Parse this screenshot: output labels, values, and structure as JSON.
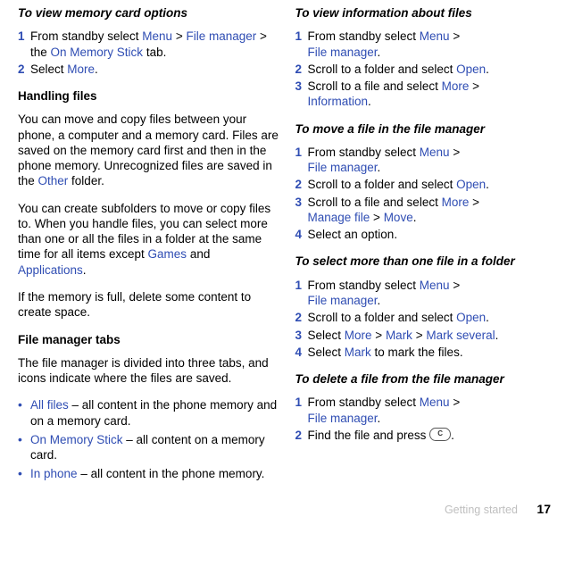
{
  "col_left": {
    "h1": "To view memory card options",
    "s1": {
      "n1": "1",
      "n2": "2",
      "t1a": "From standby select ",
      "t1_menu": "Menu",
      "t1b": " > ",
      "t1_file_manager": "File manager",
      "t1c": " > the ",
      "t1_on_mem": "On Memory Stick",
      "t1d": " tab.",
      "t2a": "Select ",
      "t2_more": "More",
      "t2b": "."
    },
    "h2": "Handling files",
    "p1a": "You can move and copy files between your phone, a computer and a memory card. Files are saved on the memory card first and then in the phone memory. Unrecognized files are saved in the ",
    "p1_other": "Other",
    "p1b": " folder.",
    "p2a": "You can create subfolders to move or copy files to. When you handle files, you can select more than one or all the files in a folder at the same time for all items except ",
    "p2_games": "Games",
    "p2b": " and ",
    "p2_apps": "Applications",
    "p2c": ".",
    "p3": "If the memory is full, delete some content to create space.",
    "h3": "File manager tabs",
    "p4": "The file manager is divided into three tabs, and icons indicate where the files are saved.",
    "b1_name": "All files",
    "b1_rest": " – all content in the phone memory and on a memory card.",
    "b2_name": "On Memory Stick",
    "b2_rest": " – all content on a memory card.",
    "b3_name": "In phone",
    "b3_rest": " – all content in the phone memory."
  },
  "col_right": {
    "h1": "To view information about files",
    "s1": {
      "n1": "1",
      "n2": "2",
      "n3": "3",
      "t1a": "From standby select ",
      "t1_menu": "Menu",
      "t1b": " > ",
      "t1_fm": "File manager",
      "t1c": ".",
      "t2a": "Scroll to a folder and select ",
      "t2_open": "Open",
      "t2b": ".",
      "t3a": "Scroll to a file and select ",
      "t3_more": "More",
      "t3b": " > ",
      "t3_info": "Information",
      "t3c": "."
    },
    "h2": "To move a file in the file manager",
    "s2": {
      "n1": "1",
      "n2": "2",
      "n3": "3",
      "n4": "4",
      "t1a": "From standby select ",
      "t1_menu": "Menu",
      "t1b": " > ",
      "t1_fm": "File manager",
      "t1c": ".",
      "t2a": "Scroll to a folder and select ",
      "t2_open": "Open",
      "t2b": ".",
      "t3a": "Scroll to a file and select ",
      "t3_more": "More",
      "t3b": " > ",
      "t3_manage": "Manage file",
      "t3c": " > ",
      "t3_move": "Move",
      "t3d": ".",
      "t4": "Select an option."
    },
    "h3": "To select more than one file in a folder",
    "s3": {
      "n1": "1",
      "n2": "2",
      "n3": "3",
      "n4": "4",
      "t1a": "From standby select ",
      "t1_menu": "Menu",
      "t1b": " > ",
      "t1_fm": "File manager",
      "t1c": ".",
      "t2a": "Scroll to a folder and select ",
      "t2_open": "Open",
      "t2b": ".",
      "t3a": "Select ",
      "t3_more": "More",
      "t3b": " > ",
      "t3_mark": "Mark",
      "t3c": " > ",
      "t3_marksev": "Mark several",
      "t3d": ".",
      "t4a": "Select ",
      "t4_mark": "Mark",
      "t4b": " to mark the files."
    },
    "h4": "To delete a file from the file manager",
    "s4": {
      "n1": "1",
      "n2": "2",
      "t1a": "From standby select ",
      "t1_menu": "Menu",
      "t1b": " > ",
      "t1_fm": "File manager",
      "t1c": ".",
      "t2a": "Find the file and press ",
      "t2b": "."
    }
  },
  "footer": {
    "section": "Getting started",
    "page": "17"
  }
}
